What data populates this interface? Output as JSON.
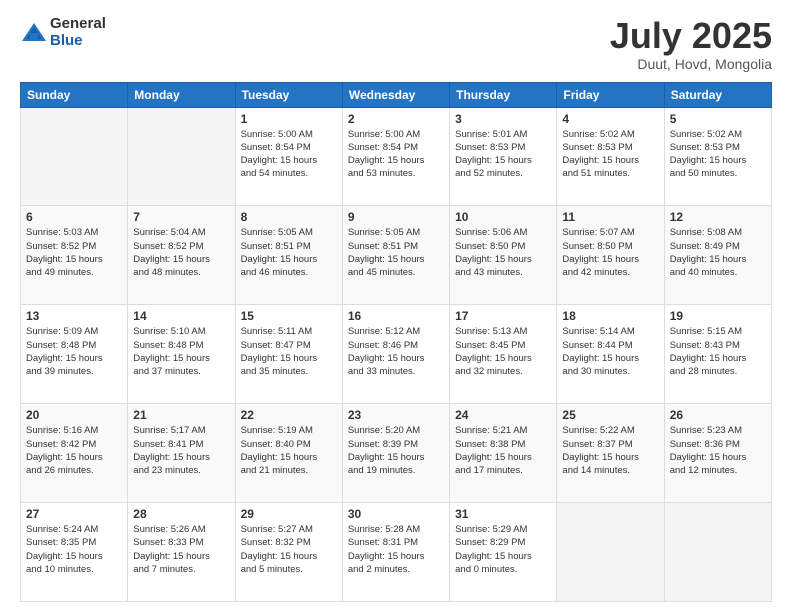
{
  "logo": {
    "general": "General",
    "blue": "Blue"
  },
  "title": {
    "month_year": "July 2025",
    "location": "Duut, Hovd, Mongolia"
  },
  "days_of_week": [
    "Sunday",
    "Monday",
    "Tuesday",
    "Wednesday",
    "Thursday",
    "Friday",
    "Saturday"
  ],
  "weeks": [
    [
      {
        "day": "",
        "info": ""
      },
      {
        "day": "",
        "info": ""
      },
      {
        "day": "1",
        "info": "Sunrise: 5:00 AM\nSunset: 8:54 PM\nDaylight: 15 hours\nand 54 minutes."
      },
      {
        "day": "2",
        "info": "Sunrise: 5:00 AM\nSunset: 8:54 PM\nDaylight: 15 hours\nand 53 minutes."
      },
      {
        "day": "3",
        "info": "Sunrise: 5:01 AM\nSunset: 8:53 PM\nDaylight: 15 hours\nand 52 minutes."
      },
      {
        "day": "4",
        "info": "Sunrise: 5:02 AM\nSunset: 8:53 PM\nDaylight: 15 hours\nand 51 minutes."
      },
      {
        "day": "5",
        "info": "Sunrise: 5:02 AM\nSunset: 8:53 PM\nDaylight: 15 hours\nand 50 minutes."
      }
    ],
    [
      {
        "day": "6",
        "info": "Sunrise: 5:03 AM\nSunset: 8:52 PM\nDaylight: 15 hours\nand 49 minutes."
      },
      {
        "day": "7",
        "info": "Sunrise: 5:04 AM\nSunset: 8:52 PM\nDaylight: 15 hours\nand 48 minutes."
      },
      {
        "day": "8",
        "info": "Sunrise: 5:05 AM\nSunset: 8:51 PM\nDaylight: 15 hours\nand 46 minutes."
      },
      {
        "day": "9",
        "info": "Sunrise: 5:05 AM\nSunset: 8:51 PM\nDaylight: 15 hours\nand 45 minutes."
      },
      {
        "day": "10",
        "info": "Sunrise: 5:06 AM\nSunset: 8:50 PM\nDaylight: 15 hours\nand 43 minutes."
      },
      {
        "day": "11",
        "info": "Sunrise: 5:07 AM\nSunset: 8:50 PM\nDaylight: 15 hours\nand 42 minutes."
      },
      {
        "day": "12",
        "info": "Sunrise: 5:08 AM\nSunset: 8:49 PM\nDaylight: 15 hours\nand 40 minutes."
      }
    ],
    [
      {
        "day": "13",
        "info": "Sunrise: 5:09 AM\nSunset: 8:48 PM\nDaylight: 15 hours\nand 39 minutes."
      },
      {
        "day": "14",
        "info": "Sunrise: 5:10 AM\nSunset: 8:48 PM\nDaylight: 15 hours\nand 37 minutes."
      },
      {
        "day": "15",
        "info": "Sunrise: 5:11 AM\nSunset: 8:47 PM\nDaylight: 15 hours\nand 35 minutes."
      },
      {
        "day": "16",
        "info": "Sunrise: 5:12 AM\nSunset: 8:46 PM\nDaylight: 15 hours\nand 33 minutes."
      },
      {
        "day": "17",
        "info": "Sunrise: 5:13 AM\nSunset: 8:45 PM\nDaylight: 15 hours\nand 32 minutes."
      },
      {
        "day": "18",
        "info": "Sunrise: 5:14 AM\nSunset: 8:44 PM\nDaylight: 15 hours\nand 30 minutes."
      },
      {
        "day": "19",
        "info": "Sunrise: 5:15 AM\nSunset: 8:43 PM\nDaylight: 15 hours\nand 28 minutes."
      }
    ],
    [
      {
        "day": "20",
        "info": "Sunrise: 5:16 AM\nSunset: 8:42 PM\nDaylight: 15 hours\nand 26 minutes."
      },
      {
        "day": "21",
        "info": "Sunrise: 5:17 AM\nSunset: 8:41 PM\nDaylight: 15 hours\nand 23 minutes."
      },
      {
        "day": "22",
        "info": "Sunrise: 5:19 AM\nSunset: 8:40 PM\nDaylight: 15 hours\nand 21 minutes."
      },
      {
        "day": "23",
        "info": "Sunrise: 5:20 AM\nSunset: 8:39 PM\nDaylight: 15 hours\nand 19 minutes."
      },
      {
        "day": "24",
        "info": "Sunrise: 5:21 AM\nSunset: 8:38 PM\nDaylight: 15 hours\nand 17 minutes."
      },
      {
        "day": "25",
        "info": "Sunrise: 5:22 AM\nSunset: 8:37 PM\nDaylight: 15 hours\nand 14 minutes."
      },
      {
        "day": "26",
        "info": "Sunrise: 5:23 AM\nSunset: 8:36 PM\nDaylight: 15 hours\nand 12 minutes."
      }
    ],
    [
      {
        "day": "27",
        "info": "Sunrise: 5:24 AM\nSunset: 8:35 PM\nDaylight: 15 hours\nand 10 minutes."
      },
      {
        "day": "28",
        "info": "Sunrise: 5:26 AM\nSunset: 8:33 PM\nDaylight: 15 hours\nand 7 minutes."
      },
      {
        "day": "29",
        "info": "Sunrise: 5:27 AM\nSunset: 8:32 PM\nDaylight: 15 hours\nand 5 minutes."
      },
      {
        "day": "30",
        "info": "Sunrise: 5:28 AM\nSunset: 8:31 PM\nDaylight: 15 hours\nand 2 minutes."
      },
      {
        "day": "31",
        "info": "Sunrise: 5:29 AM\nSunset: 8:29 PM\nDaylight: 15 hours\nand 0 minutes."
      },
      {
        "day": "",
        "info": ""
      },
      {
        "day": "",
        "info": ""
      }
    ]
  ]
}
